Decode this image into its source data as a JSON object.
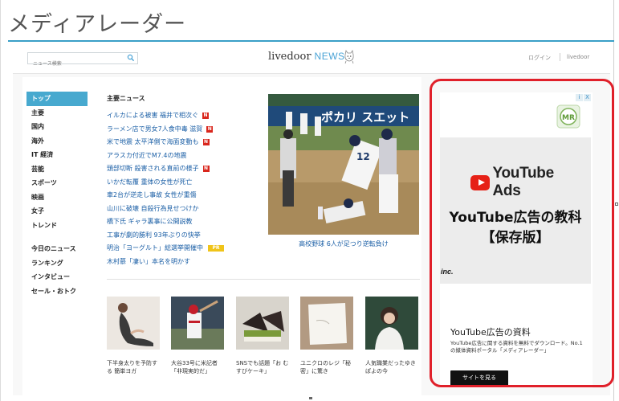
{
  "page": {
    "title": "メディアレーダー"
  },
  "header": {
    "search_placeholder": "ニュース検索",
    "logo_main": "livedoor",
    "logo_news": "NEWS",
    "login_label": "ログイン",
    "livedoor_label": "livedoor"
  },
  "nav": {
    "items": [
      "トップ",
      "主要",
      "国内",
      "海外",
      "IT 経済",
      "芸能",
      "スポーツ",
      "映画",
      "女子",
      "トレンド"
    ],
    "sub_items": [
      "今日のニュース",
      "ランキング",
      "インタビュー",
      "セール・おトク"
    ]
  },
  "news": {
    "heading": "主要ニュース",
    "items": [
      {
        "text": "イルカによる被害 福井で相次ぐ",
        "badge": "N"
      },
      {
        "text": "ラーメン店で男女7人食中毒 滋賀",
        "badge": "N"
      },
      {
        "text": "米で地震 太平洋側で海面変動も",
        "badge": "N"
      },
      {
        "text": "アラスカ付近でM7.4の地震",
        "badge": ""
      },
      {
        "text": "頭部切断 殺害される直前の様子",
        "badge": "N"
      },
      {
        "text": "いかだ転覆 重体の女性が死亡",
        "badge": ""
      },
      {
        "text": "車2台が逆走し事故 女性が重傷",
        "badge": ""
      },
      {
        "text": "山川に破壊 自殺行為見せつけか",
        "badge": ""
      },
      {
        "text": "橋下氏 ギャラ裏事に公開説教",
        "badge": ""
      },
      {
        "text": "工事が劇的勝利 93年ぶりの快挙",
        "badge": ""
      },
      {
        "text": "明治「ヨーグルト」総選挙開催中",
        "badge": "PR"
      },
      {
        "text": "木村慕「凄い」本名を明かす",
        "badge": ""
      }
    ],
    "feature_caption": "高校野球 6人が足つり逆転負け",
    "feature_banner": "ポカリ スエット"
  },
  "thumbs": [
    {
      "caption": "下半身太りを予防する 簡単ヨガ"
    },
    {
      "caption": "大谷33号に米記者 「非現実的だ」"
    },
    {
      "caption": "SNSでも話題「お むすびケーキ」"
    },
    {
      "caption": "ユニクロのレジ「秘 密」に驚き"
    },
    {
      "caption": "人気職業だったゆき ぽよの今"
    }
  ],
  "ad": {
    "choices": [
      "i",
      "X"
    ],
    "mr_logo_text": "MR",
    "yt_logo_text": "YouTube Ads",
    "title_line1": "YouTube広告の教科",
    "title_line2": "【保存版】",
    "inc": "inc.",
    "headline": "YouTube広告の資料",
    "description": "YouTube広告に関する資料を無料でダウンロード。No.1の媒体資料ポータル「メディアレーダー」",
    "cta": "サイトを見る"
  },
  "colors": {
    "accent_blue": "#47a9cf",
    "link_blue": "#1b5fa6",
    "badge_red": "#d9261c",
    "badge_pr": "#f0c419",
    "ad_border": "#e0202a",
    "youtube_red": "#e62117"
  }
}
